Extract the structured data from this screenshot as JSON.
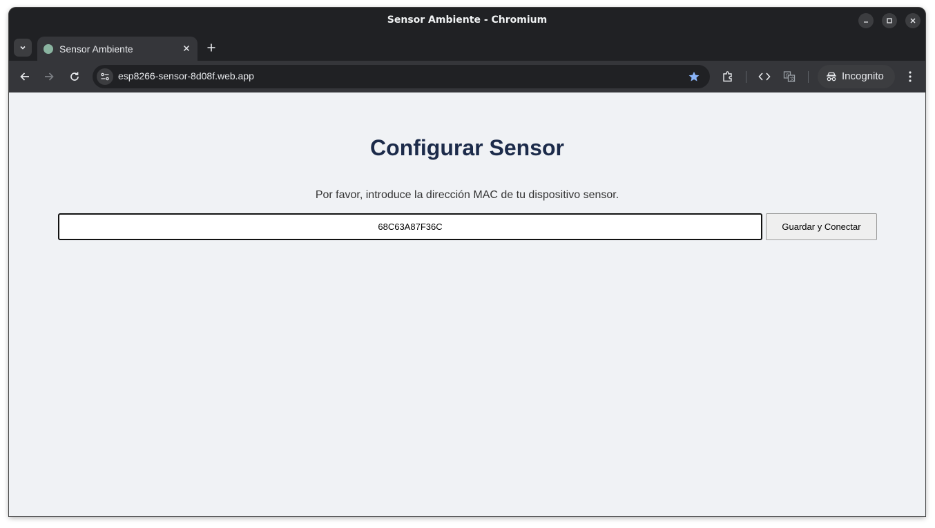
{
  "window": {
    "title": "Sensor Ambiente - Chromium"
  },
  "tabs": [
    {
      "label": "Sensor Ambiente",
      "active": true
    }
  ],
  "toolbar": {
    "url": "esp8266-sensor-8d08f.web.app",
    "incognito_label": "Incognito",
    "bookmarked": true
  },
  "page": {
    "title": "Configurar Sensor",
    "description": "Por favor, introduce la dirección MAC de tu dispositivo sensor.",
    "mac_input_value": "68C63A87F36C",
    "save_button_label": "Guardar y Conectar"
  },
  "colors": {
    "chrome_dark": "#202124",
    "toolbar": "#35363a",
    "page_background": "#f0f2f5",
    "heading": "#1c2b4a",
    "star_accent": "#8ab4f8"
  },
  "icons": [
    "tab-search-icon",
    "close-icon",
    "plus-icon",
    "back-arrow-icon",
    "forward-arrow-icon",
    "reload-icon",
    "site-settings-icon",
    "star-icon",
    "extensions-icon",
    "code-icon",
    "translate-icon",
    "incognito-icon",
    "menu-dots-icon",
    "minimize-icon",
    "maximize-icon"
  ]
}
